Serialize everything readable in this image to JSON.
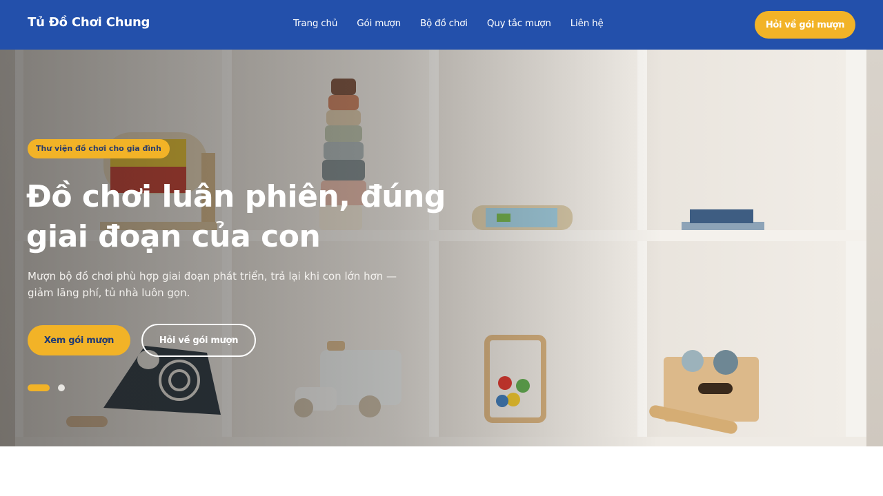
{
  "header": {
    "brand": "Tủ Đồ Chơi Chung",
    "menu": [
      {
        "label": "Trang chủ"
      },
      {
        "label": "Gói mượn"
      },
      {
        "label": "Bộ đồ chơi"
      },
      {
        "label": "Quy tắc mượn"
      },
      {
        "label": "Liên hệ"
      }
    ],
    "cta_label": "Hỏi về gói mượn"
  },
  "hero": {
    "badge": "Thư viện đồ chơi cho gia đình",
    "title": "Đồ chơi luân phiên, đúng giai đoạn của con",
    "subtitle": "Mượn bộ đồ chơi phù hợp giai đoạn phát triển, trả lại khi con lớn hơn — giảm lãng phí, tủ nhà luôn gọn.",
    "primary_button": "Xem gói mượn",
    "secondary_button": "Hỏi về gói mượn",
    "carousel": {
      "current": 1,
      "total": 2
    }
  },
  "colors": {
    "nav_bg": "#2350ab",
    "accent": "#f2b327",
    "text_on_dark": "#ffffff"
  },
  "icons": {
    "hero_image": "toy-shelf-photo"
  }
}
